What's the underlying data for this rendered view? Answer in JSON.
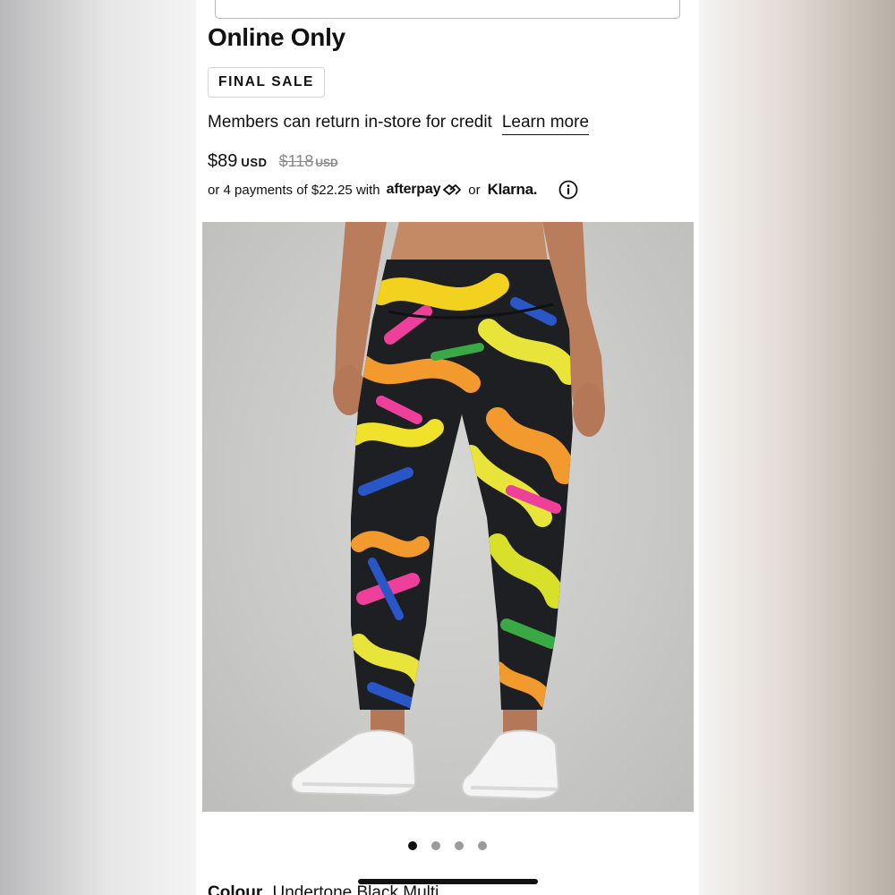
{
  "product": {
    "availability": "Online Only",
    "badge": "FINAL SALE",
    "returns_text": "Members can return in-store for credit",
    "learn_more": "Learn more",
    "price": "$89",
    "price_currency": "USD",
    "original_price": "$118",
    "original_currency": "USD",
    "installments_text": "or 4 payments of $22.25 with",
    "afterpay_label": "afterpay",
    "or_text": "or",
    "klarna_label": "Klarna.",
    "info_icon": "info-icon"
  },
  "gallery": {
    "image_alt": "Leggings in Undertone Black Multi print worn by model",
    "dots": [
      {
        "active": true
      },
      {
        "active": false
      },
      {
        "active": false
      },
      {
        "active": false
      }
    ]
  },
  "colour": {
    "label": "Colour",
    "value": "Undertone Black Multi"
  },
  "colors": {
    "text": "#111111",
    "muted": "#8a8a8a",
    "dot_active": "#111111",
    "dot_inactive": "#9b9b9b"
  }
}
